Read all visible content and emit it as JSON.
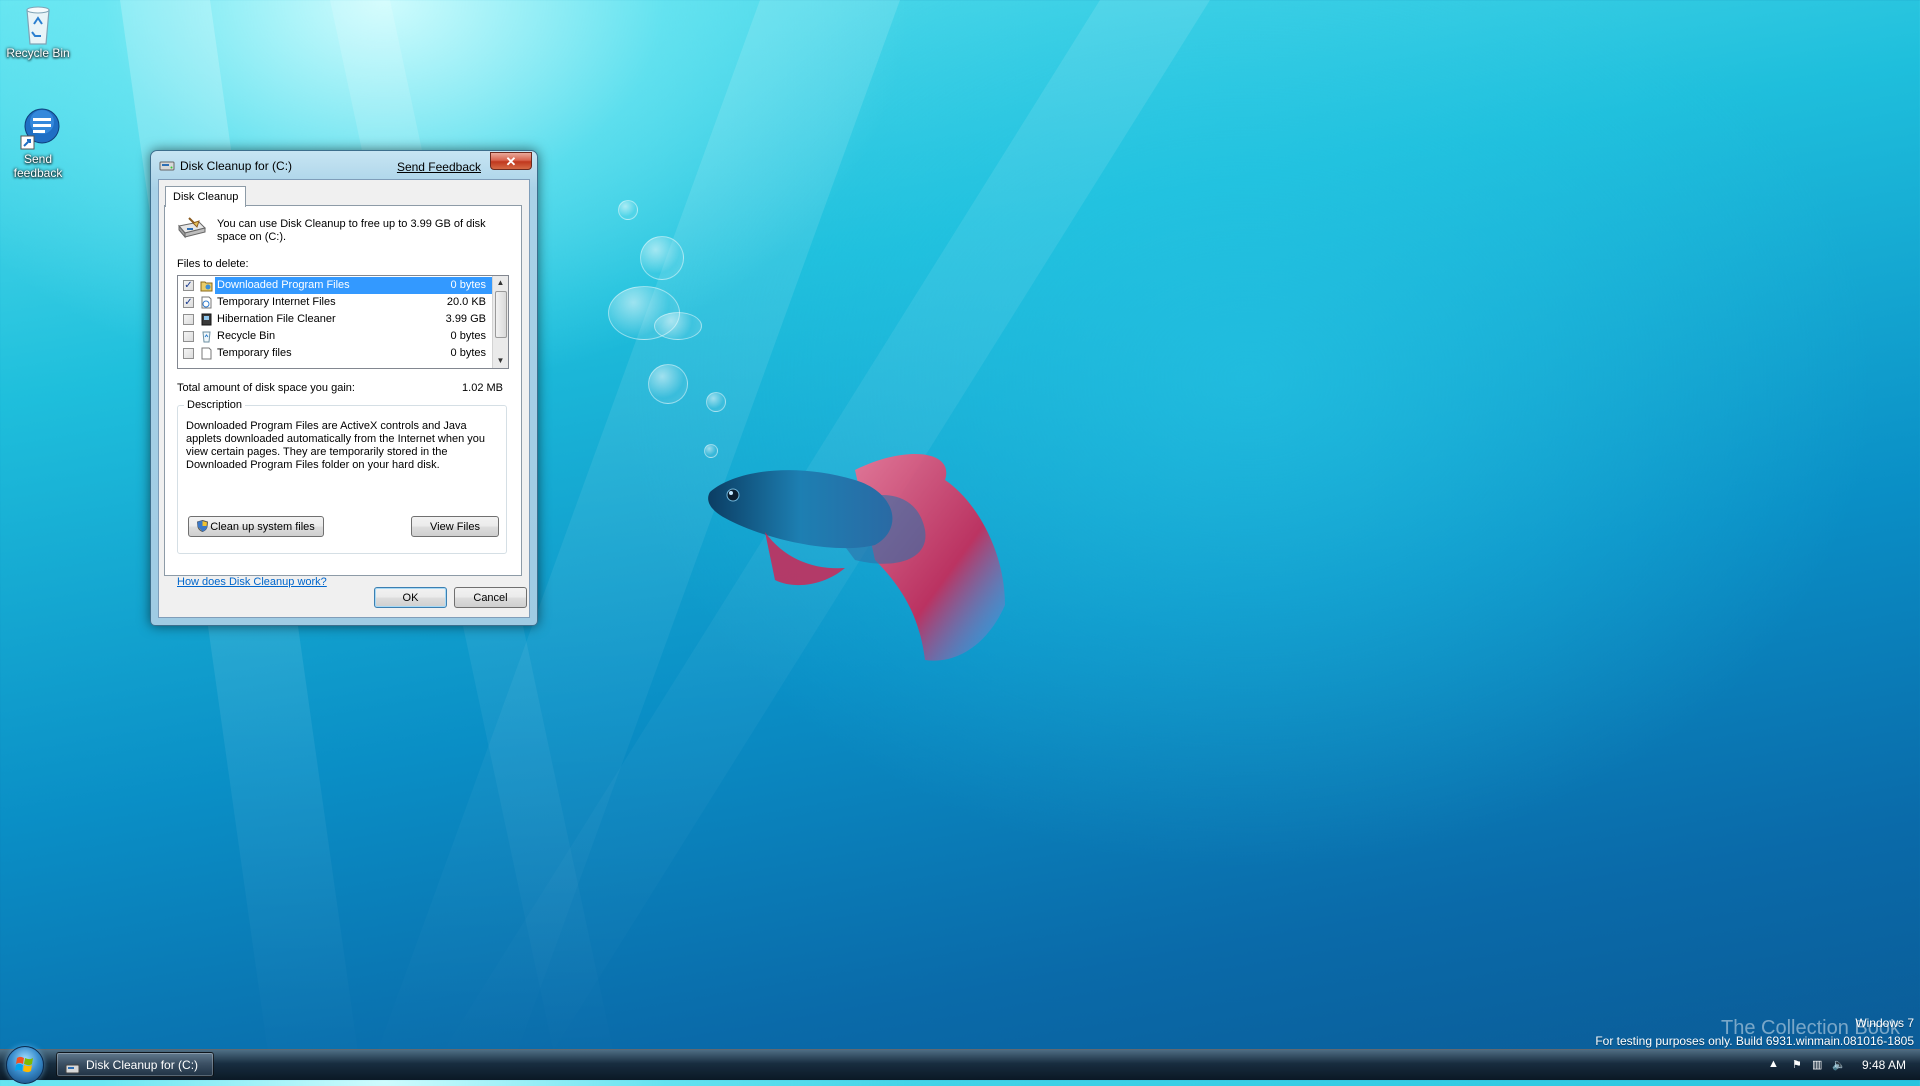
{
  "desktop": {
    "icons": [
      {
        "label": "Recycle Bin"
      },
      {
        "label": "Send feedback"
      }
    ],
    "watermark": {
      "product": "Windows 7",
      "build": "For testing purposes only. Build 6931.winmain.081016-1805",
      "site": "The Collection Book"
    }
  },
  "window": {
    "title": "Disk Cleanup for  (C:)",
    "send_feedback": "Send Feedback",
    "close_glyph": "✕",
    "tab": "Disk Cleanup",
    "intro": "You can use Disk Cleanup to free up to 3.99 GB of disk space on  (C:).",
    "files_label": "Files to delete:",
    "files": [
      {
        "name": "Downloaded Program Files",
        "size": "0 bytes",
        "checked": true,
        "selected": true
      },
      {
        "name": "Temporary Internet Files",
        "size": "20.0 KB",
        "checked": true,
        "selected": false
      },
      {
        "name": "Hibernation File Cleaner",
        "size": "3.99 GB",
        "checked": false,
        "selected": false
      },
      {
        "name": "Recycle Bin",
        "size": "0 bytes",
        "checked": false,
        "selected": false
      },
      {
        "name": "Temporary files",
        "size": "0 bytes",
        "checked": false,
        "selected": false
      }
    ],
    "total_label": "Total amount of disk space you gain:",
    "total_value": "1.02 MB",
    "description_legend": "Description",
    "description": "Downloaded Program Files are ActiveX controls and Java applets downloaded automatically from the Internet when you view certain pages. They are temporarily stored in the Downloaded Program Files folder on your hard disk.",
    "cleanup_button": "Clean up system files",
    "view_files_button": "View Files",
    "help_link": "How does Disk Cleanup work?",
    "ok_button": "OK",
    "cancel_button": "Cancel"
  },
  "taskbar": {
    "task_label": "Disk Cleanup for  (C:)",
    "clock": "9:48 AM"
  },
  "colors": {
    "selection": "#3399ff",
    "link": "#0066cc",
    "close_button": "#c7412a"
  }
}
